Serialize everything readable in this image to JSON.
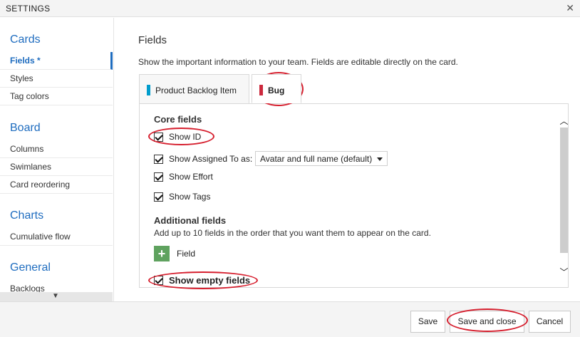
{
  "window": {
    "title": "SETTINGS",
    "close_icon": "close-icon"
  },
  "sidebar": {
    "sections": [
      {
        "title": "Cards",
        "items": [
          {
            "label": "Fields *",
            "active": true
          },
          {
            "label": "Styles"
          },
          {
            "label": "Tag colors"
          }
        ]
      },
      {
        "title": "Board",
        "items": [
          {
            "label": "Columns"
          },
          {
            "label": "Swimlanes"
          },
          {
            "label": "Card reordering"
          }
        ]
      },
      {
        "title": "Charts",
        "items": [
          {
            "label": "Cumulative flow"
          }
        ]
      },
      {
        "title": "General",
        "items": [
          {
            "label": "Backlogs"
          }
        ]
      }
    ],
    "scroll_icon": "chevron-down-icon"
  },
  "main": {
    "title": "Fields",
    "description": "Show the important information to your team. Fields are editable directly on the card.",
    "tabs": [
      {
        "label": "Product Backlog Item",
        "color": "#009ccc"
      },
      {
        "label": "Bug",
        "color": "#cc293d",
        "selected": true
      }
    ],
    "core_fields": {
      "title": "Core fields",
      "items": [
        {
          "label": "Show ID",
          "checked": true
        },
        {
          "label": "Show Assigned To as:",
          "checked": true,
          "select_value": "Avatar and full name (default)"
        },
        {
          "label": "Show Effort",
          "checked": true
        },
        {
          "label": "Show Tags",
          "checked": true
        }
      ]
    },
    "additional_fields": {
      "title": "Additional fields",
      "description": "Add up to 10 fields in the order that you want them to appear on the card.",
      "add_label": "Field",
      "add_icon": "plus-icon"
    },
    "show_empty": {
      "label": "Show empty fields",
      "checked": true
    }
  },
  "footer": {
    "save": "Save",
    "save_close": "Save and close",
    "cancel": "Cancel"
  },
  "colors": {
    "accent": "#1e6cbf",
    "annotation": "#d61f2e",
    "add_button": "#5fa25f"
  }
}
